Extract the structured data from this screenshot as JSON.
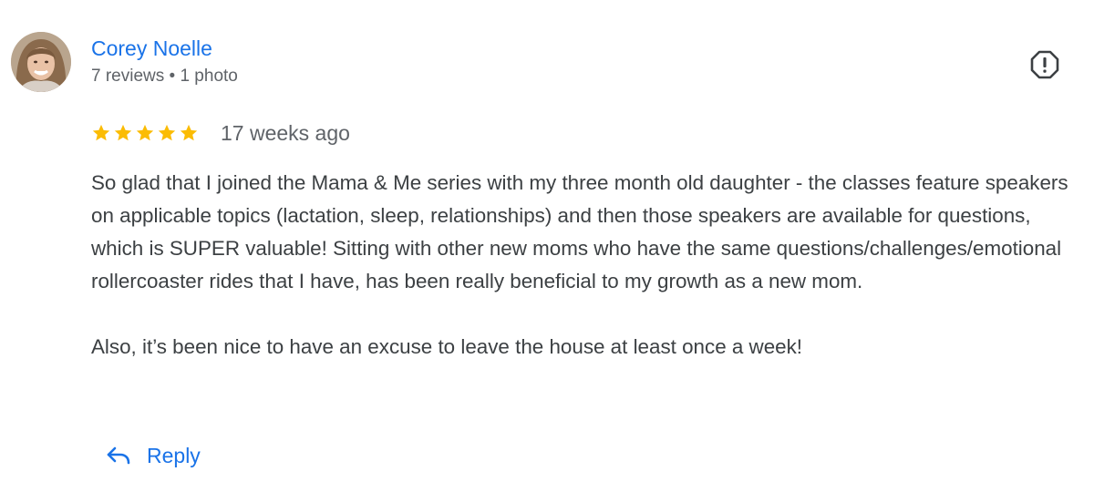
{
  "review": {
    "author": {
      "name": "Corey Noelle",
      "meta": "7 reviews • 1 photo"
    },
    "rating": {
      "stars": 5,
      "max": 5
    },
    "date": "17 weeks ago",
    "paragraphs": [
      "So glad that I joined the Mama & Me series with my three month old daughter - the classes feature speakers on applicable topics (lactation, sleep, relationships) and then those speakers are available for questions, which is SUPER valuable! Sitting with other new moms who have the same questions/challenges/emotional rollercoaster rides that I have, has been really beneficial to my growth as a new mom.",
      "Also, it’s been nice to have an excuse to leave the house at least once a week!"
    ],
    "actions": {
      "reply_label": "Reply"
    }
  },
  "icons": {
    "report": "report-flag-icon",
    "reply": "reply-arrow-icon",
    "star": "star-icon"
  },
  "colors": {
    "link": "#1a73e8",
    "star": "#fbbc04",
    "meta_text": "#5f6368",
    "body_text": "#3c4043"
  }
}
